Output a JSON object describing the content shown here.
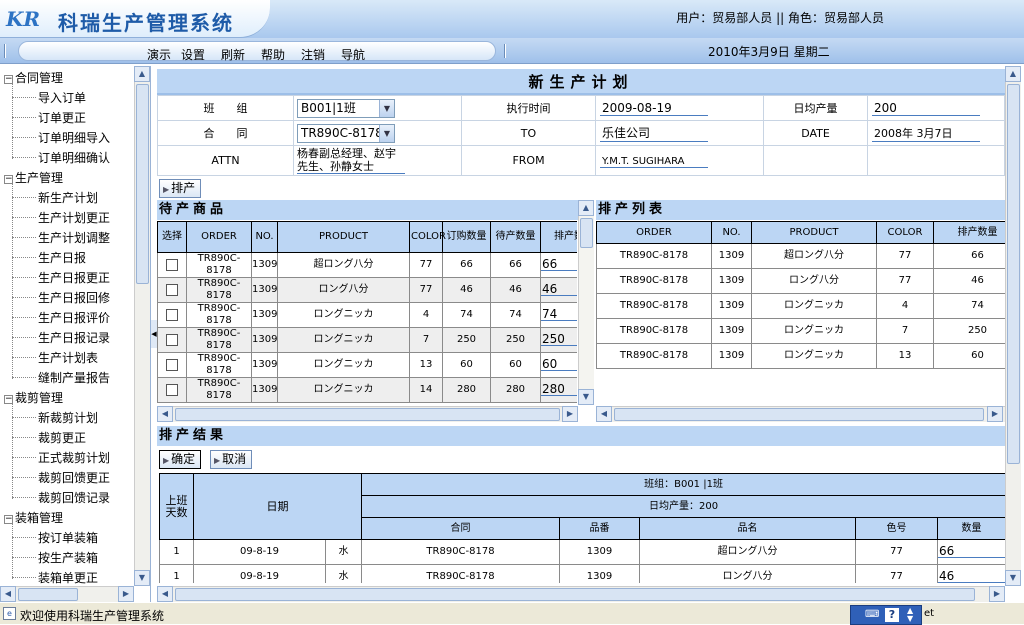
{
  "app": {
    "title": "科瑞生产管理系统",
    "logo": "KR"
  },
  "header": {
    "user_info": "用户：贸易部人员 || 角色：贸易部人员",
    "date": "2010年3月9日 星期二"
  },
  "menu": [
    "演示",
    "设置",
    "刷新",
    "帮助",
    "注销",
    "导航"
  ],
  "sidebar": {
    "groups": [
      {
        "label": "合同管理",
        "items": [
          "导入订单",
          "订单更正",
          "订单明细导入",
          "订单明细确认"
        ]
      },
      {
        "label": "生产管理",
        "items": [
          "新生产计划",
          "生产计划更正",
          "生产计划调整",
          "生产日报",
          "生产日报更正",
          "生产日报回修",
          "生产日报评价",
          "生产日报记录",
          "生产计划表",
          "缝制产量报告"
        ]
      },
      {
        "label": "裁剪管理",
        "items": [
          "新裁剪计划",
          "裁剪更正",
          "正式裁剪计划",
          "裁剪回馈更正",
          "裁剪回馈记录"
        ]
      },
      {
        "label": "装箱管理",
        "items": [
          "按订单装箱",
          "按生产装箱",
          "装箱单更正"
        ]
      }
    ]
  },
  "plan": {
    "title": "新生产计划",
    "team_label": "班　　组",
    "team_value": "B001|1班",
    "exec_time_label": "执行时间",
    "exec_time_value": "2009-08-19",
    "daily_output_label": "日均产量",
    "daily_output_value": "200",
    "contract_label": "合　　同",
    "contract_value": "TR890C-8178",
    "to_label": "TO",
    "to_value": "乐佳公司",
    "date_label": "DATE",
    "date_value": "2008年 3月7日",
    "attn_label": "ATTN",
    "attn_value_line1": "杨春副总经理、赵宇",
    "attn_value_line2": "先生、孙静女士",
    "from_label": "FROM",
    "from_value": "Y.M.T. SUGIHARA"
  },
  "buttons": {
    "schedule": "排产",
    "confirm": "确定",
    "cancel": "取消"
  },
  "pending": {
    "title": "待产商品",
    "headers": [
      "选择",
      "ORDER",
      "NO.",
      "PRODUCT",
      "COLOR",
      "订购数量",
      "待产数量",
      "排产数"
    ],
    "rows": [
      {
        "order": "TR890C-8178",
        "no": "1309",
        "product": "超ロング八分",
        "color": "77",
        "ordered": "66",
        "pending": "66",
        "qty": "66"
      },
      {
        "order": "TR890C-8178",
        "no": "1309",
        "product": "ロング八分",
        "color": "77",
        "ordered": "46",
        "pending": "46",
        "qty": "46"
      },
      {
        "order": "TR890C-8178",
        "no": "1309",
        "product": "ロングニッカ",
        "color": "4",
        "ordered": "74",
        "pending": "74",
        "qty": "74"
      },
      {
        "order": "TR890C-8178",
        "no": "1309",
        "product": "ロングニッカ",
        "color": "7",
        "ordered": "250",
        "pending": "250",
        "qty": "250"
      },
      {
        "order": "TR890C-8178",
        "no": "1309",
        "product": "ロングニッカ",
        "color": "13",
        "ordered": "60",
        "pending": "60",
        "qty": "60"
      },
      {
        "order": "TR890C-8178",
        "no": "1309",
        "product": "ロングニッカ",
        "color": "14",
        "ordered": "280",
        "pending": "280",
        "qty": "280"
      }
    ]
  },
  "schedule": {
    "title": "排产列表",
    "headers": [
      "ORDER",
      "NO.",
      "PRODUCT",
      "COLOR",
      "排产数量"
    ],
    "rows": [
      {
        "order": "TR890C-8178",
        "no": "1309",
        "product": "超ロング八分",
        "color": "77",
        "qty": "66"
      },
      {
        "order": "TR890C-8178",
        "no": "1309",
        "product": "ロング八分",
        "color": "77",
        "qty": "46"
      },
      {
        "order": "TR890C-8178",
        "no": "1309",
        "product": "ロングニッカ",
        "color": "4",
        "qty": "74"
      },
      {
        "order": "TR890C-8178",
        "no": "1309",
        "product": "ロングニッカ",
        "color": "7",
        "qty": "250"
      },
      {
        "order": "TR890C-8178",
        "no": "1309",
        "product": "ロングニッカ",
        "color": "13",
        "qty": "60"
      }
    ]
  },
  "result": {
    "title": "排产结果",
    "days_header": "上班天数",
    "date_header": "日期",
    "team_line": "班组：B001 |1班",
    "output_line": "日均产量：200",
    "sub_headers": [
      "合同",
      "品番",
      "品名",
      "色号",
      "数量"
    ],
    "rows": [
      {
        "day": "1",
        "date": "09-8-19",
        "weekday": "水",
        "contract": "TR890C-8178",
        "no": "1309",
        "name": "超ロング八分",
        "color": "77",
        "qty": "66"
      },
      {
        "day": "1",
        "date": "09-8-19",
        "weekday": "水",
        "contract": "TR890C-8178",
        "no": "1309",
        "name": "ロング八分",
        "color": "77",
        "qty": "46"
      }
    ]
  },
  "status": {
    "text": "欢迎使用科瑞生产管理系统",
    "tray_text": "et"
  }
}
